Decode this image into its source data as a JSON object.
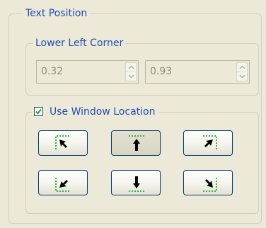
{
  "text_position": {
    "title": "Text Position",
    "lower_left_corner": {
      "title": "Lower Left Corner",
      "x_value": "0.32",
      "y_value": "0.93"
    },
    "use_window_location": {
      "label": "Use Window Location",
      "checked": true
    },
    "position_buttons": [
      {
        "id": "upper-left",
        "icon": "arrow-upper-left-icon",
        "pressed": false
      },
      {
        "id": "upper-center",
        "icon": "arrow-up-center-icon",
        "pressed": true
      },
      {
        "id": "upper-right",
        "icon": "arrow-upper-right-icon",
        "pressed": false
      },
      {
        "id": "lower-left",
        "icon": "arrow-lower-left-icon",
        "pressed": false
      },
      {
        "id": "lower-center",
        "icon": "arrow-down-center-icon",
        "pressed": false
      },
      {
        "id": "lower-right",
        "icon": "arrow-lower-right-icon",
        "pressed": false
      }
    ]
  },
  "colors": {
    "background": "#ece9d8",
    "label_text": "#1f50ae",
    "dotted_frame": "#33b53a",
    "arrow": "#000000",
    "button_border": "#003c74"
  }
}
